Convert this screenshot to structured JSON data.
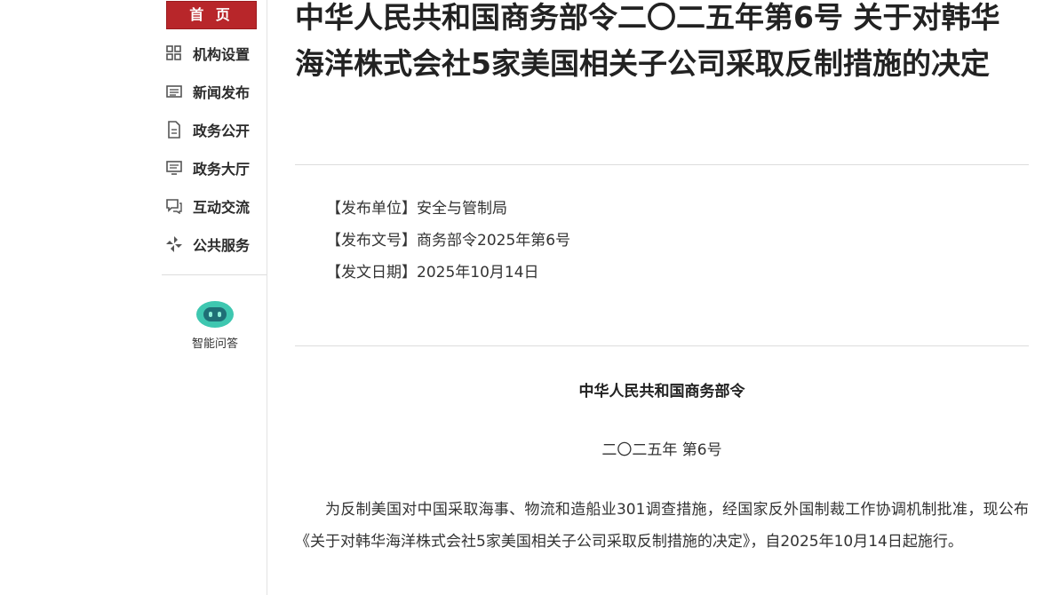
{
  "sidebar": {
    "home_label": "首 页",
    "items": [
      {
        "label": "机构设置",
        "icon": "grid-icon"
      },
      {
        "label": "新闻发布",
        "icon": "news-icon"
      },
      {
        "label": "政务公开",
        "icon": "document-icon"
      },
      {
        "label": "政务大厅",
        "icon": "hall-icon"
      },
      {
        "label": "互动交流",
        "icon": "chat-icon"
      },
      {
        "label": "公共服务",
        "icon": "service-icon"
      }
    ],
    "ai": {
      "label": "智能问答",
      "icon": "robot-icon"
    }
  },
  "article": {
    "title": "中华人民共和国商务部令二〇二五年第6号 关于对韩华海洋株式会社5家美国相关子公司采取反制措施的决定",
    "meta": {
      "unit": "【发布单位】安全与管制局",
      "doc_number": "【发布文号】商务部令2025年第6号",
      "date": "【发文日期】2025年10月14日"
    },
    "issuer": "中华人民共和国商务部令",
    "order_number": "二〇二五年 第6号",
    "body": "为反制美国对中国采取海事、物流和造船业301调查措施，经国家反外国制裁工作协调机制批准，现公布《关于对韩华海洋株式会社5家美国相关子公司采取反制措施的决定》，自2025年10月14日起施行。"
  },
  "colors": {
    "brand_red": "#b8262a",
    "ai_teal": "#3ec7b0"
  }
}
